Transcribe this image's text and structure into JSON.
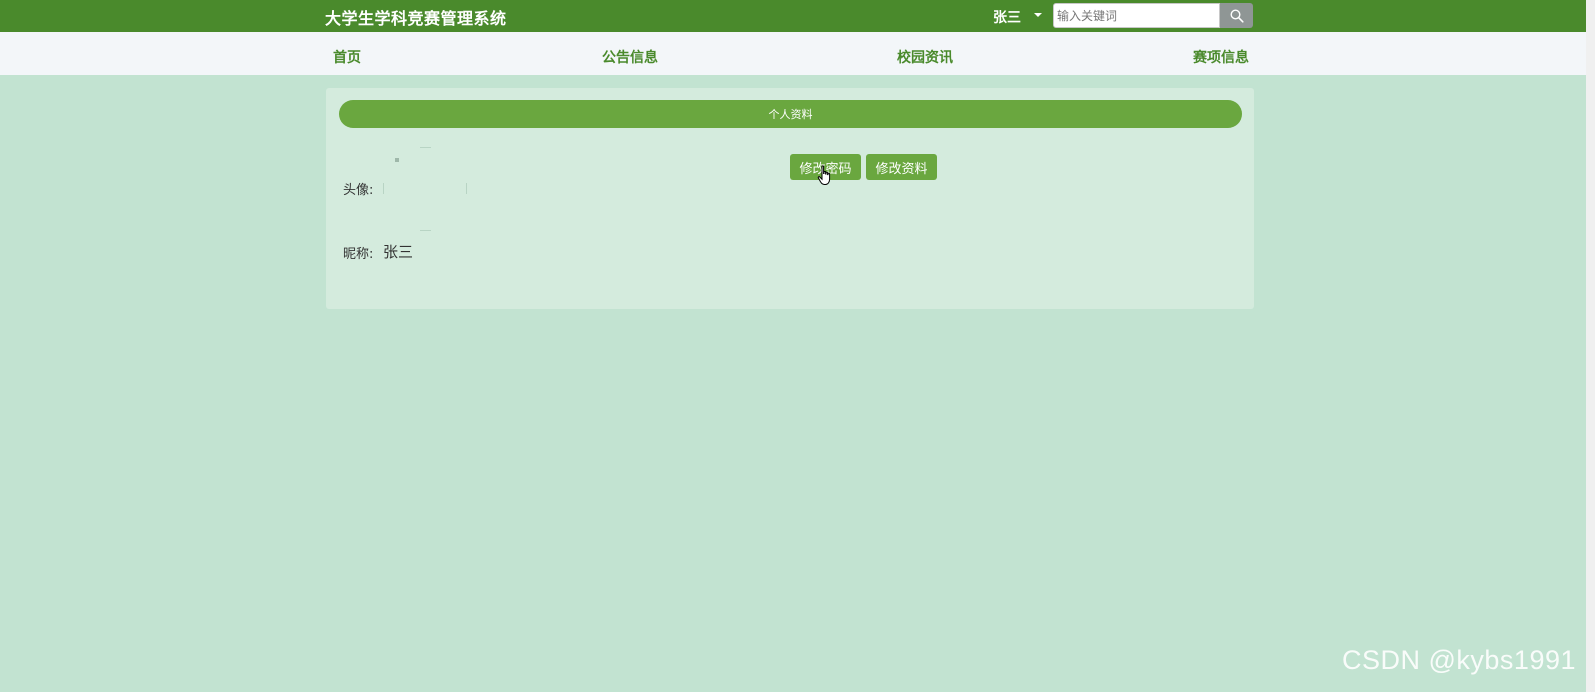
{
  "header": {
    "site_title": "大学生学科竞赛管理系统",
    "user_name": "张三",
    "search_placeholder": "输入关键词",
    "search_icon": "search-icon",
    "colors": {
      "topbar": "#4a8a2c",
      "accent": "#6aa73f",
      "background": "#c2e3d1"
    }
  },
  "nav": {
    "items": [
      {
        "label": "首页"
      },
      {
        "label": "公告信息"
      },
      {
        "label": "校园资讯"
      },
      {
        "label": "赛项信息"
      }
    ]
  },
  "profile": {
    "header": "个人资料",
    "change_password_label": "修改密码",
    "edit_profile_label": "修改资料",
    "avatar_label": "头像:",
    "nickname_label": "昵称:",
    "nickname_value": "张三"
  },
  "watermark": "CSDN @kybs1991"
}
